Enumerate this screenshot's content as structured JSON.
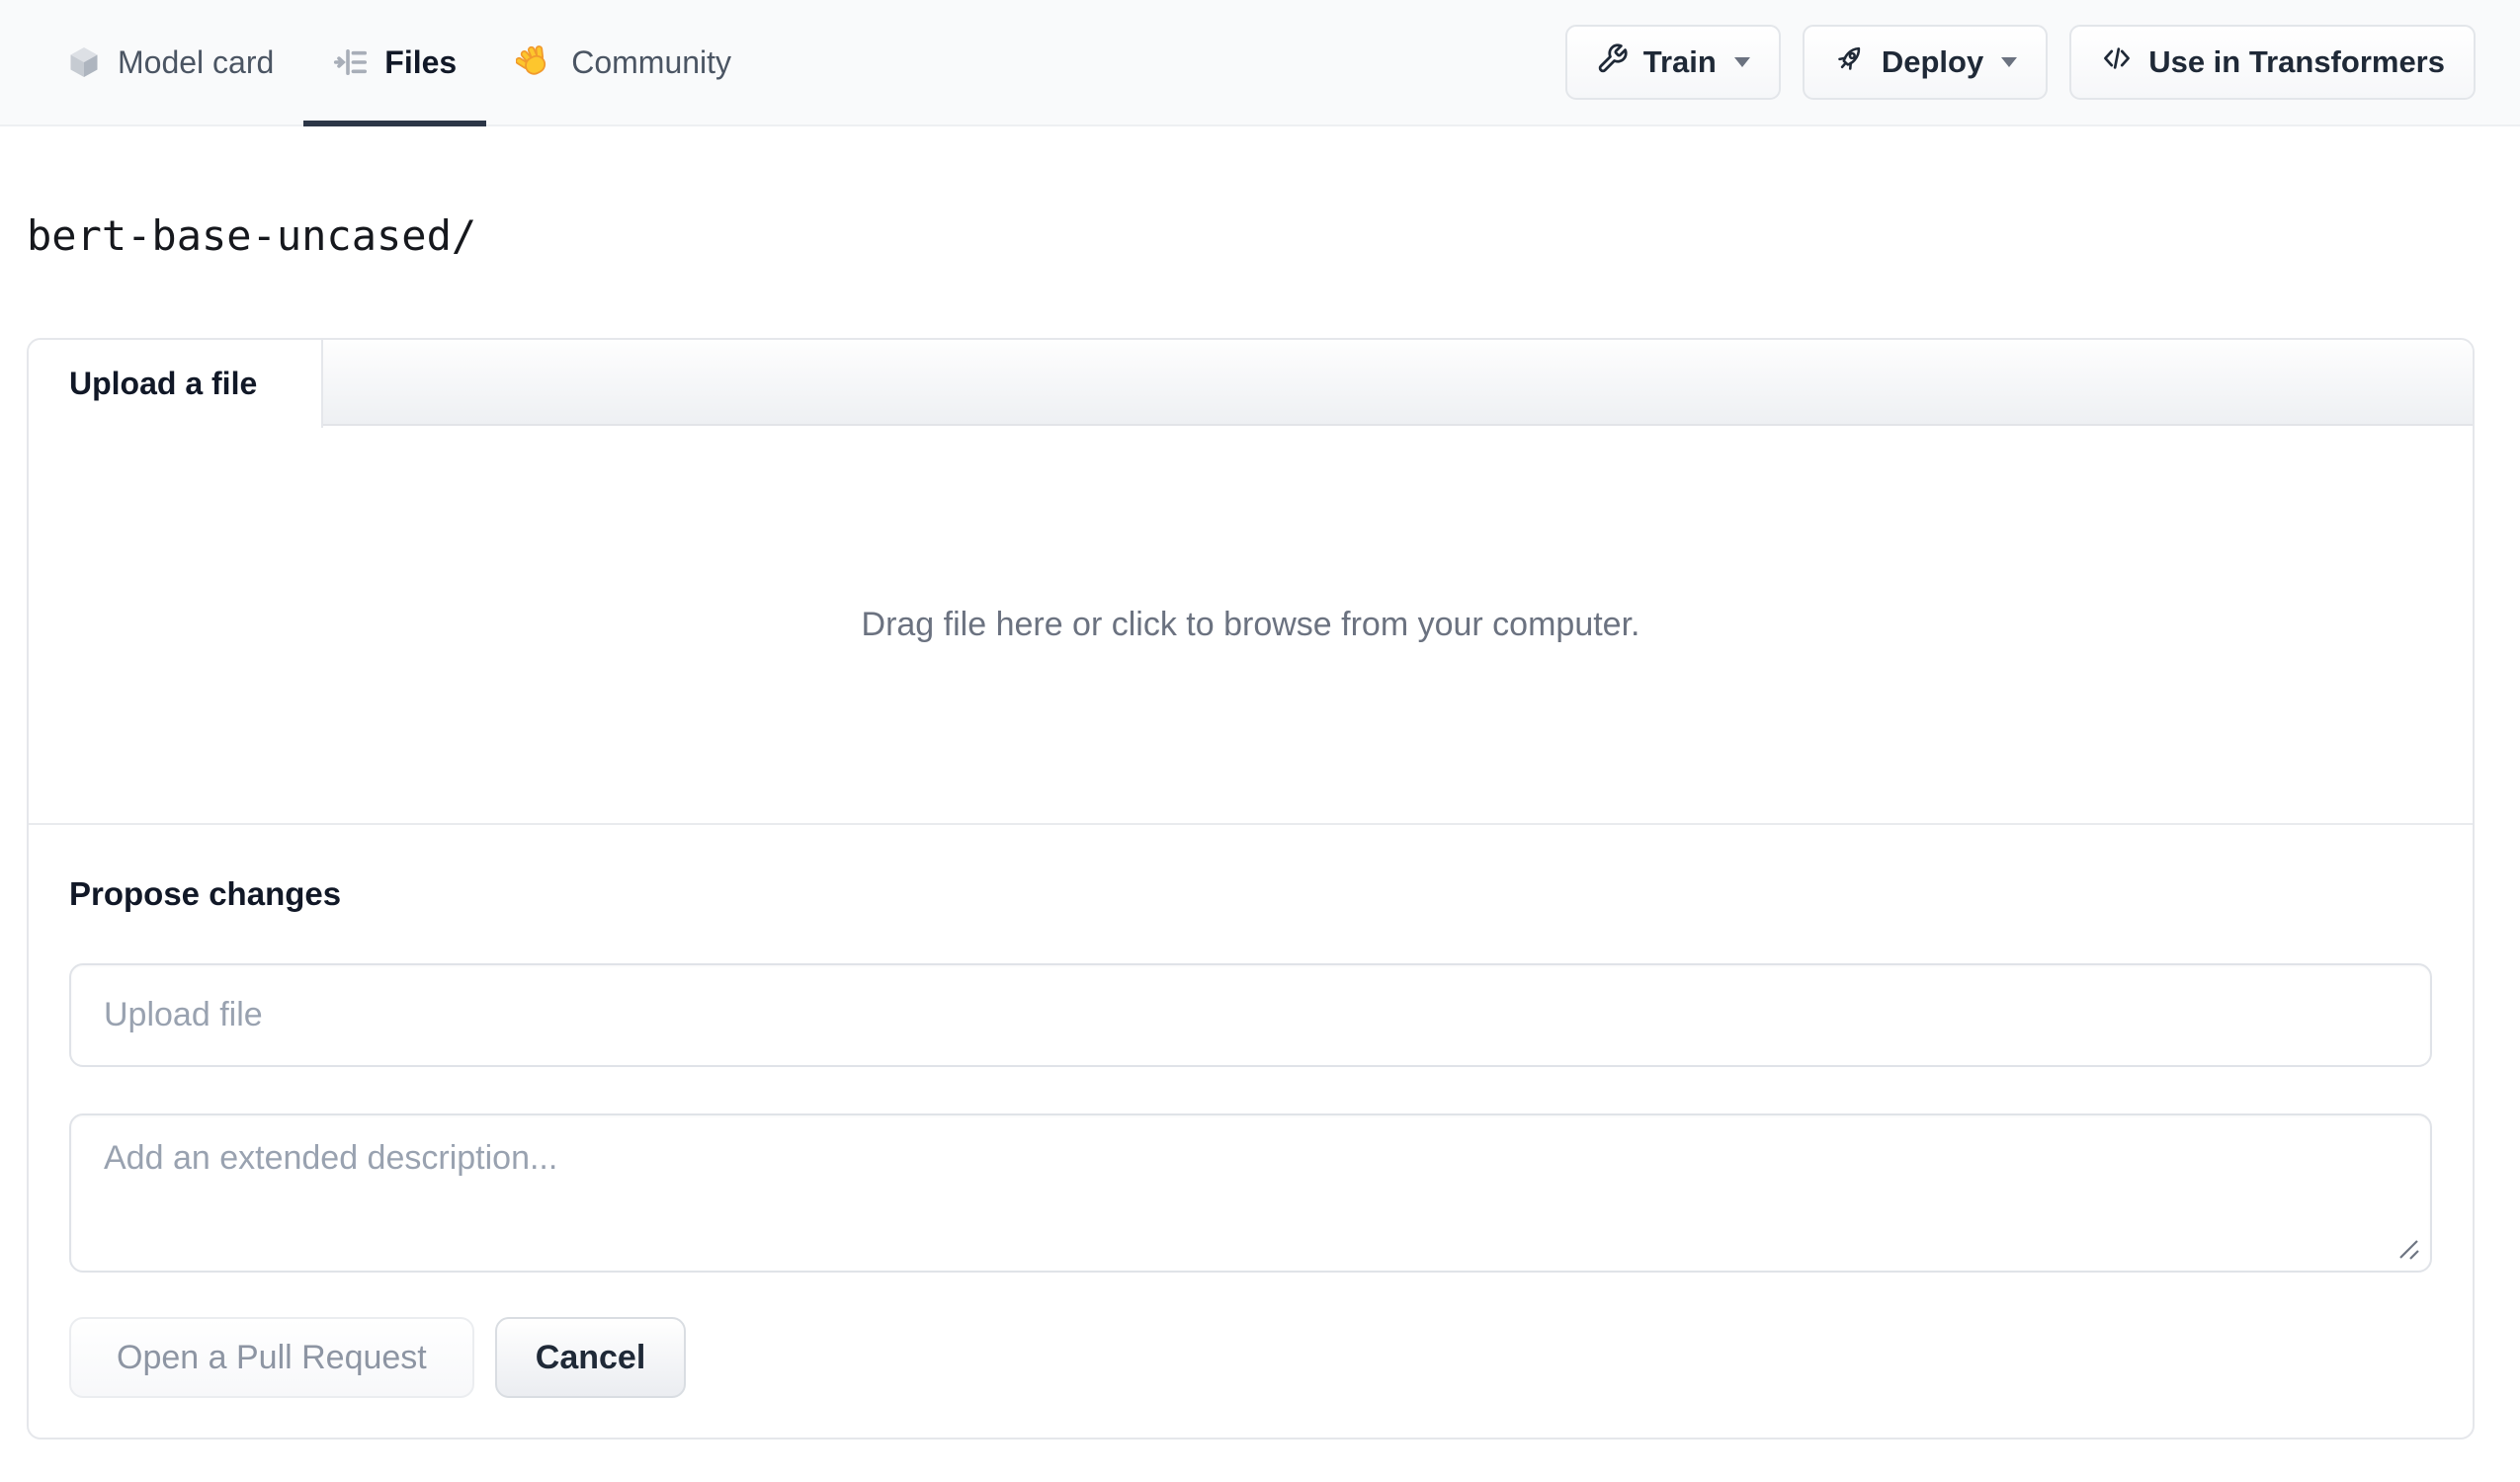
{
  "header": {
    "tabs": [
      {
        "label": "Model card",
        "icon": "model-cube-icon",
        "active": false
      },
      {
        "label": "Files",
        "icon": "files-list-icon",
        "active": true
      },
      {
        "label": "Community",
        "icon": "waving-hand-icon",
        "active": false
      }
    ],
    "actions": [
      {
        "label": "Train",
        "icon": "wrench-icon",
        "has_caret": true
      },
      {
        "label": "Deploy",
        "icon": "rocket-icon",
        "has_caret": true
      },
      {
        "label": "Use in Transformers",
        "icon": "code-icon",
        "has_caret": false
      }
    ]
  },
  "path": {
    "text": "bert-base-uncased/"
  },
  "upload_card": {
    "tab_label": "Upload a file",
    "dropzone_text": "Drag file here or click to browse from your computer.",
    "propose": {
      "heading": "Propose changes",
      "filename_placeholder": "Upload file",
      "description_placeholder": "Add an extended description...",
      "submit_label": "Open a Pull Request",
      "cancel_label": "Cancel"
    }
  },
  "colors": {
    "header_bg": "#f9fafb",
    "active_tab_underline": "#2c3647",
    "muted_text": "#6b7280",
    "placeholder_text": "#99a2b0",
    "border": "#e5e7eb",
    "disabled_button_text": "#8d95a3",
    "hand_emoji_yellow": "#fdc62d"
  }
}
